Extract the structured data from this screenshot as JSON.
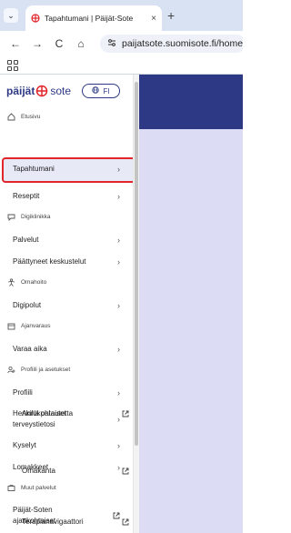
{
  "browser": {
    "tab_title": "Tapahtumani | Päijät-Sote",
    "tab_close": "×",
    "new_tab": "+",
    "url": "paijatsote.suomisote.fi/home",
    "back": "←",
    "forward": "→",
    "reload": "C",
    "home": "⌂",
    "dropdown": "⌄"
  },
  "brand": {
    "name_part1": "päijät",
    "name_part2": "sote",
    "language": "FI"
  },
  "menu": {
    "home": "Etusivu",
    "events": "Tapahtumani",
    "prescriptions": "Reseptit",
    "digiclinic_section": "Digiklinikka",
    "services": "Palvelut",
    "ended_conversations": "Päättyneet keskustelut",
    "selfcare_section": "Omahoito",
    "digipaths": "Digipolut",
    "booking_section": "Ajanvaraus",
    "book_time": "Varaa aika",
    "profile_section": "Profiili ja asetukset",
    "profile": "Profiili",
    "personal_health_line1": "Henkilökohtaiset",
    "personal_health_line2": "terveystietosi",
    "surveys": "Kyselyt",
    "forms": "Lomakkeet",
    "other_services_section": "Muut palvelut",
    "current_affairs_line1": "Päijät-Soten",
    "current_affairs_line2": "ajankohtaiset",
    "feedback": "Anna palautetta",
    "omakanta": "Omakanta",
    "therapy_navigator": "Terapianavigaattori",
    "chevron": "›"
  },
  "colors": {
    "brand_navy": "#2d3985",
    "highlight_red": "#e0252b",
    "content_bg": "#dcdcf4"
  }
}
